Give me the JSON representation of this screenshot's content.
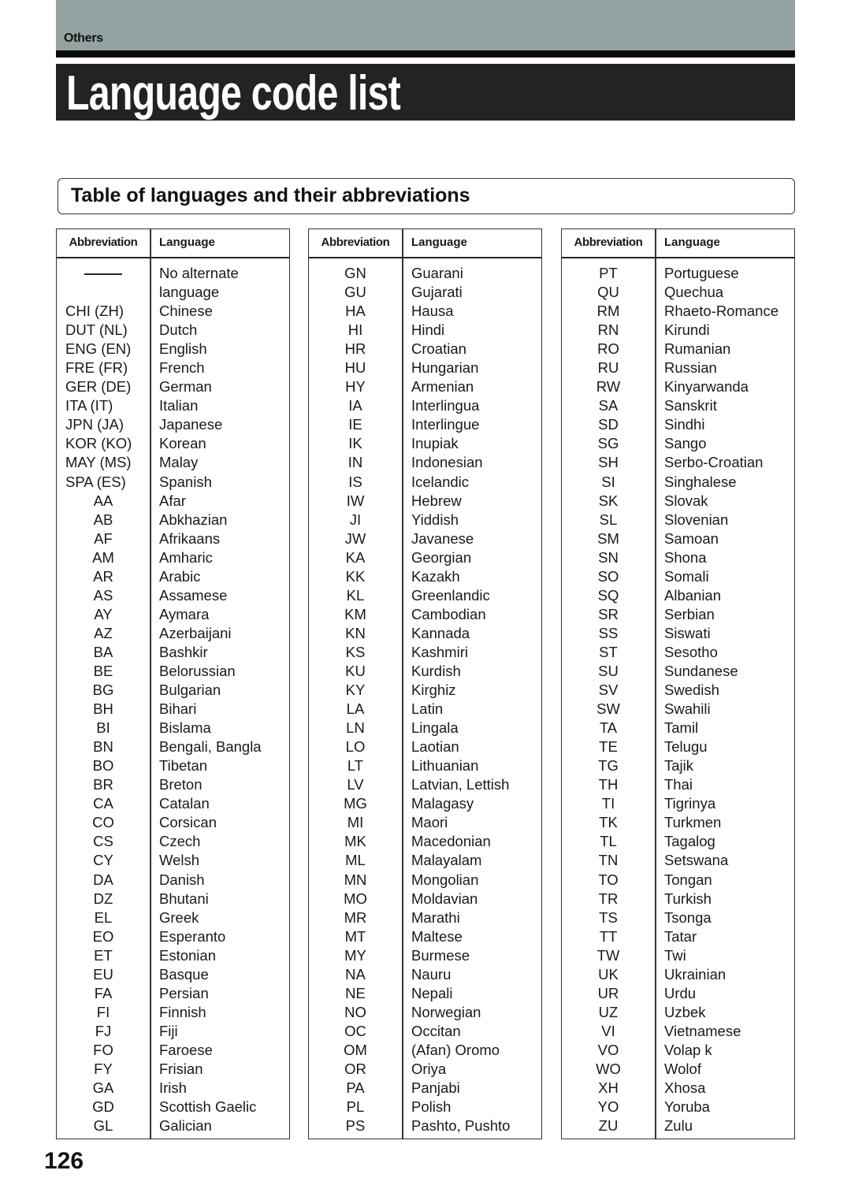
{
  "header": {
    "section_label": "Others",
    "title": "Language code list"
  },
  "subtitle": "Table of languages and their abbreviations",
  "table_headers": {
    "abbreviation": "Abbreviation",
    "language": "Language"
  },
  "tables": [
    {
      "rows": [
        {
          "abbr": "—",
          "lang": "No alternate",
          "is_dash": true
        },
        {
          "abbr": "",
          "lang": "language"
        },
        {
          "abbr": "CHI (ZH)",
          "lang": "Chinese",
          "left": true
        },
        {
          "abbr": "DUT (NL)",
          "lang": "Dutch",
          "left": true
        },
        {
          "abbr": "ENG (EN)",
          "lang": "English",
          "left": true
        },
        {
          "abbr": "FRE (FR)",
          "lang": "French",
          "left": true
        },
        {
          "abbr": "GER (DE)",
          "lang": "German",
          "left": true
        },
        {
          "abbr": "ITA (IT)",
          "lang": "Italian",
          "left": true
        },
        {
          "abbr": "JPN (JA)",
          "lang": "Japanese",
          "left": true
        },
        {
          "abbr": "KOR (KO)",
          "lang": "Korean",
          "left": true
        },
        {
          "abbr": "MAY (MS)",
          "lang": "Malay",
          "left": true
        },
        {
          "abbr": "SPA (ES)",
          "lang": "Spanish",
          "left": true
        },
        {
          "abbr": "AA",
          "lang": "Afar"
        },
        {
          "abbr": "AB",
          "lang": "Abkhazian"
        },
        {
          "abbr": "AF",
          "lang": "Afrikaans"
        },
        {
          "abbr": "AM",
          "lang": "Amharic"
        },
        {
          "abbr": "AR",
          "lang": "Arabic"
        },
        {
          "abbr": "AS",
          "lang": "Assamese"
        },
        {
          "abbr": "AY",
          "lang": "Aymara"
        },
        {
          "abbr": "AZ",
          "lang": "Azerbaijani"
        },
        {
          "abbr": "BA",
          "lang": "Bashkir"
        },
        {
          "abbr": "BE",
          "lang": "Belorussian"
        },
        {
          "abbr": "BG",
          "lang": "Bulgarian"
        },
        {
          "abbr": "BH",
          "lang": "Bihari"
        },
        {
          "abbr": "BI",
          "lang": "Bislama"
        },
        {
          "abbr": "BN",
          "lang": "Bengali, Bangla"
        },
        {
          "abbr": "BO",
          "lang": "Tibetan"
        },
        {
          "abbr": "BR",
          "lang": "Breton"
        },
        {
          "abbr": "CA",
          "lang": "Catalan"
        },
        {
          "abbr": "CO",
          "lang": "Corsican"
        },
        {
          "abbr": "CS",
          "lang": "Czech"
        },
        {
          "abbr": "CY",
          "lang": "Welsh"
        },
        {
          "abbr": "DA",
          "lang": "Danish"
        },
        {
          "abbr": "DZ",
          "lang": "Bhutani"
        },
        {
          "abbr": "EL",
          "lang": "Greek"
        },
        {
          "abbr": "EO",
          "lang": "Esperanto"
        },
        {
          "abbr": "ET",
          "lang": "Estonian"
        },
        {
          "abbr": "EU",
          "lang": "Basque"
        },
        {
          "abbr": "FA",
          "lang": "Persian"
        },
        {
          "abbr": "FI",
          "lang": "Finnish"
        },
        {
          "abbr": "FJ",
          "lang": "Fiji"
        },
        {
          "abbr": "FO",
          "lang": "Faroese"
        },
        {
          "abbr": "FY",
          "lang": "Frisian"
        },
        {
          "abbr": "GA",
          "lang": "Irish"
        },
        {
          "abbr": "GD",
          "lang": "Scottish Gaelic"
        },
        {
          "abbr": "GL",
          "lang": "Galician"
        }
      ]
    },
    {
      "rows": [
        {
          "abbr": "GN",
          "lang": "Guarani"
        },
        {
          "abbr": "GU",
          "lang": "Gujarati"
        },
        {
          "abbr": "HA",
          "lang": "Hausa"
        },
        {
          "abbr": "HI",
          "lang": "Hindi"
        },
        {
          "abbr": "HR",
          "lang": "Croatian"
        },
        {
          "abbr": "HU",
          "lang": "Hungarian"
        },
        {
          "abbr": "HY",
          "lang": "Armenian"
        },
        {
          "abbr": "IA",
          "lang": "Interlingua"
        },
        {
          "abbr": "IE",
          "lang": "Interlingue"
        },
        {
          "abbr": "IK",
          "lang": "Inupiak"
        },
        {
          "abbr": "IN",
          "lang": "Indonesian"
        },
        {
          "abbr": "IS",
          "lang": "Icelandic"
        },
        {
          "abbr": "IW",
          "lang": "Hebrew"
        },
        {
          "abbr": "JI",
          "lang": "Yiddish"
        },
        {
          "abbr": "JW",
          "lang": "Javanese"
        },
        {
          "abbr": "KA",
          "lang": "Georgian"
        },
        {
          "abbr": "KK",
          "lang": "Kazakh"
        },
        {
          "abbr": "KL",
          "lang": "Greenlandic"
        },
        {
          "abbr": "KM",
          "lang": "Cambodian"
        },
        {
          "abbr": "KN",
          "lang": "Kannada"
        },
        {
          "abbr": "KS",
          "lang": "Kashmiri"
        },
        {
          "abbr": "KU",
          "lang": "Kurdish"
        },
        {
          "abbr": "KY",
          "lang": "Kirghiz"
        },
        {
          "abbr": "LA",
          "lang": "Latin"
        },
        {
          "abbr": "LN",
          "lang": "Lingala"
        },
        {
          "abbr": "LO",
          "lang": "Laotian"
        },
        {
          "abbr": "LT",
          "lang": "Lithuanian"
        },
        {
          "abbr": "LV",
          "lang": "Latvian, Lettish"
        },
        {
          "abbr": "MG",
          "lang": "Malagasy"
        },
        {
          "abbr": "MI",
          "lang": "Maori"
        },
        {
          "abbr": "MK",
          "lang": "Macedonian"
        },
        {
          "abbr": "ML",
          "lang": "Malayalam"
        },
        {
          "abbr": "MN",
          "lang": "Mongolian"
        },
        {
          "abbr": "MO",
          "lang": "Moldavian"
        },
        {
          "abbr": "MR",
          "lang": "Marathi"
        },
        {
          "abbr": "MT",
          "lang": "Maltese"
        },
        {
          "abbr": "MY",
          "lang": "Burmese"
        },
        {
          "abbr": "NA",
          "lang": "Nauru"
        },
        {
          "abbr": "NE",
          "lang": "Nepali"
        },
        {
          "abbr": "NO",
          "lang": "Norwegian"
        },
        {
          "abbr": "OC",
          "lang": "Occitan"
        },
        {
          "abbr": "OM",
          "lang": "(Afan) Oromo"
        },
        {
          "abbr": "OR",
          "lang": "Oriya"
        },
        {
          "abbr": "PA",
          "lang": "Panjabi"
        },
        {
          "abbr": "PL",
          "lang": "Polish"
        },
        {
          "abbr": "PS",
          "lang": "Pashto, Pushto"
        }
      ]
    },
    {
      "rows": [
        {
          "abbr": "PT",
          "lang": "Portuguese"
        },
        {
          "abbr": "QU",
          "lang": "Quechua"
        },
        {
          "abbr": "RM",
          "lang": "Rhaeto-Romance"
        },
        {
          "abbr": "RN",
          "lang": "Kirundi"
        },
        {
          "abbr": "RO",
          "lang": "Rumanian"
        },
        {
          "abbr": "RU",
          "lang": "Russian"
        },
        {
          "abbr": "RW",
          "lang": "Kinyarwanda"
        },
        {
          "abbr": "SA",
          "lang": "Sanskrit"
        },
        {
          "abbr": "SD",
          "lang": "Sindhi"
        },
        {
          "abbr": "SG",
          "lang": "Sango"
        },
        {
          "abbr": "SH",
          "lang": "Serbo-Croatian"
        },
        {
          "abbr": "SI",
          "lang": "Singhalese"
        },
        {
          "abbr": "SK",
          "lang": "Slovak"
        },
        {
          "abbr": "SL",
          "lang": "Slovenian"
        },
        {
          "abbr": "SM",
          "lang": "Samoan"
        },
        {
          "abbr": "SN",
          "lang": "Shona"
        },
        {
          "abbr": "SO",
          "lang": "Somali"
        },
        {
          "abbr": "SQ",
          "lang": "Albanian"
        },
        {
          "abbr": "SR",
          "lang": "Serbian"
        },
        {
          "abbr": "SS",
          "lang": "Siswati"
        },
        {
          "abbr": "ST",
          "lang": "Sesotho"
        },
        {
          "abbr": "SU",
          "lang": "Sundanese"
        },
        {
          "abbr": "SV",
          "lang": "Swedish"
        },
        {
          "abbr": "SW",
          "lang": "Swahili"
        },
        {
          "abbr": "TA",
          "lang": "Tamil"
        },
        {
          "abbr": "TE",
          "lang": "Telugu"
        },
        {
          "abbr": "TG",
          "lang": "Tajik"
        },
        {
          "abbr": "TH",
          "lang": "Thai"
        },
        {
          "abbr": "TI",
          "lang": "Tigrinya"
        },
        {
          "abbr": "TK",
          "lang": "Turkmen"
        },
        {
          "abbr": "TL",
          "lang": "Tagalog"
        },
        {
          "abbr": "TN",
          "lang": "Setswana"
        },
        {
          "abbr": "TO",
          "lang": "Tongan"
        },
        {
          "abbr": "TR",
          "lang": "Turkish"
        },
        {
          "abbr": "TS",
          "lang": "Tsonga"
        },
        {
          "abbr": "TT",
          "lang": "Tatar"
        },
        {
          "abbr": "TW",
          "lang": "Twi"
        },
        {
          "abbr": "UK",
          "lang": "Ukrainian"
        },
        {
          "abbr": "UR",
          "lang": "Urdu"
        },
        {
          "abbr": "UZ",
          "lang": "Uzbek"
        },
        {
          "abbr": "VI",
          "lang": "Vietnamese"
        },
        {
          "abbr": "VO",
          "lang": "Volap  k"
        },
        {
          "abbr": "WO",
          "lang": "Wolof"
        },
        {
          "abbr": "XH",
          "lang": "Xhosa"
        },
        {
          "abbr": "YO",
          "lang": "Yoruba"
        },
        {
          "abbr": "ZU",
          "lang": "Zulu"
        }
      ]
    }
  ],
  "page_number": "126",
  "colors": {
    "header_band": "#93a3a1",
    "title_bar": "#222424",
    "title_text": "#ffffff",
    "rule": "#0a0a0a"
  }
}
